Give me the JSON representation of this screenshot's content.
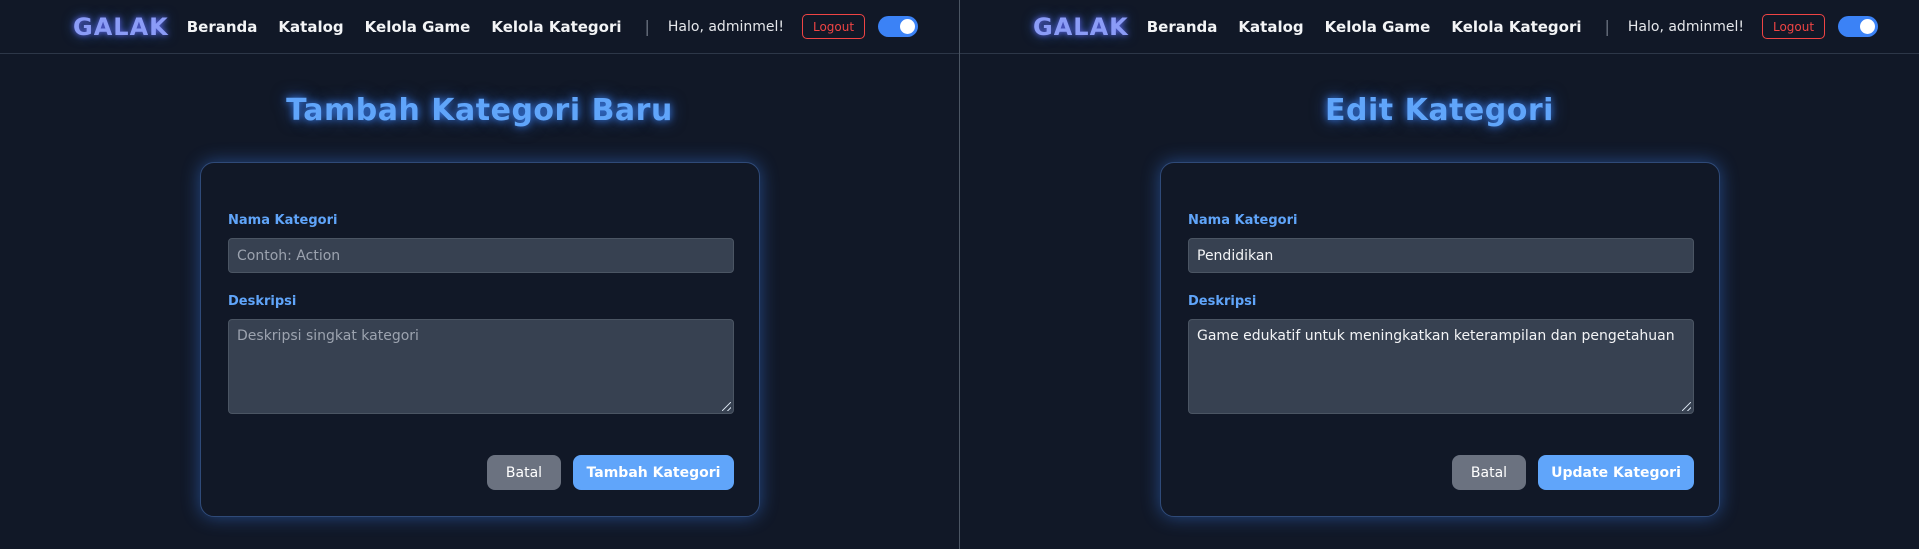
{
  "nav": {
    "logo": "GALAK",
    "links": [
      "Beranda",
      "Katalog",
      "Kelola Game",
      "Kelola Kategori"
    ],
    "separator": "|",
    "greeting": "Halo, adminmel!",
    "logout_label": "Logout",
    "theme_toggle_on": true
  },
  "add_form": {
    "title": "Tambah Kategori Baru",
    "name_label": "Nama Kategori",
    "name_placeholder": "Contoh: Action",
    "name_value": "",
    "desc_label": "Deskripsi",
    "desc_placeholder": "Deskripsi singkat kategori",
    "desc_value": "",
    "cancel_label": "Batal",
    "submit_label": "Tambah Kategori"
  },
  "edit_form": {
    "title": "Edit Kategori",
    "name_label": "Nama Kategori",
    "name_value": "Pendidikan",
    "desc_label": "Deskripsi",
    "desc_value": "Game edukatif untuk meningkatkan keterampilan dan pengetahuan",
    "cancel_label": "Batal",
    "submit_label": "Update Kategori"
  },
  "colors": {
    "accent": "#60a5fa",
    "background": "#111827",
    "input_bg": "#374151",
    "logout": "#ef4444",
    "toggle": "#3b82f6"
  }
}
